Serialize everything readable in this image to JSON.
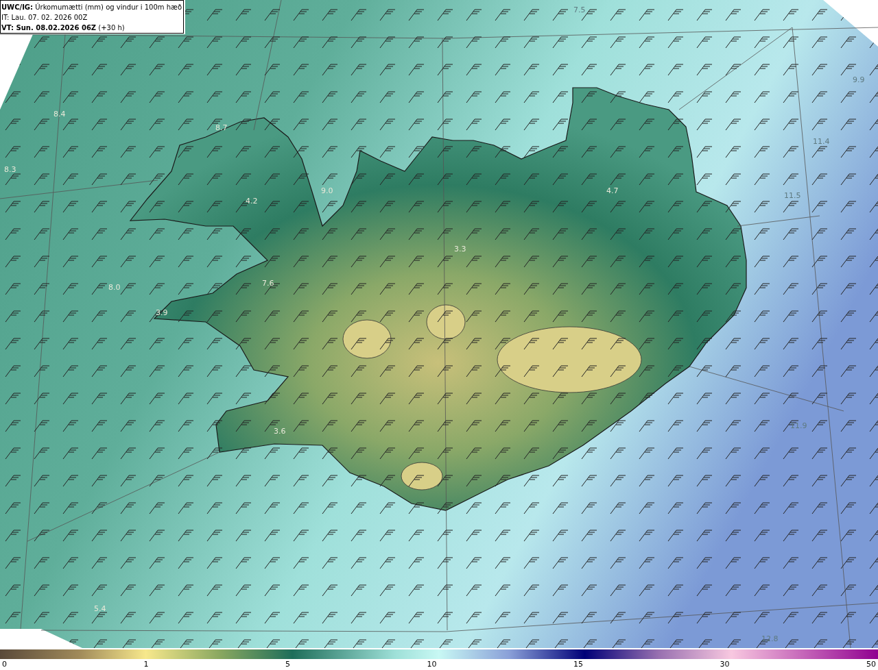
{
  "header": {
    "title": "**UWC/IG:** Úrkomumætti (mm) og vindur i 100m hæð",
    "initial_time": "IT: Lau. 07. 02. 2026 00Z",
    "valid_time": "**VT: Sun. 08.02.2026 06Z** (+30 h)"
  },
  "map_labels": [
    "7.5",
    "9.9",
    "8.4",
    "8.7",
    "8.3",
    "9.0",
    "4.2",
    "11.4",
    "4.7",
    "11.5",
    "3.3",
    "7.6",
    "8.0",
    "3.9",
    "3.6",
    "11.9",
    "5.4",
    "12.8"
  ],
  "colorbar": {
    "ticks": [
      "0",
      "1",
      "5",
      "10",
      "15",
      "30",
      "50"
    ]
  }
}
